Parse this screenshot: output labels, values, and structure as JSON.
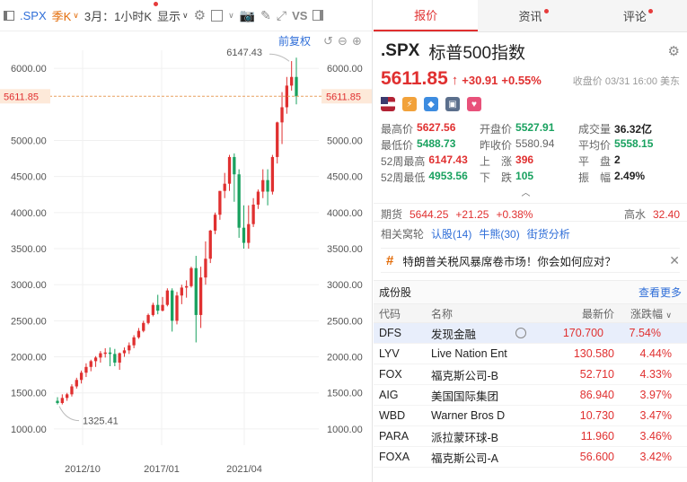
{
  "toolbar": {
    "symbol": ".SPX",
    "period": "季K",
    "interval": "3月：1小时K",
    "display": "显示",
    "vs": "VS",
    "restore": "前复权"
  },
  "chart_data": {
    "type": "candlestick",
    "y_ticks": [
      "1000.00",
      "1500.00",
      "2000.00",
      "2500.00",
      "3000.00",
      "3500.00",
      "4000.00",
      "4500.00",
      "5000.00",
      "6000.00"
    ],
    "x_ticks": [
      "2012/10",
      "2017/01",
      "2021/04"
    ],
    "ylim": [
      775,
      6250
    ],
    "current_price": "5611.85",
    "high_label": "6147.43",
    "low_label": "1325.41",
    "candles": [
      {
        "o": 1390,
        "h": 1440,
        "l": 1340,
        "c": 1360
      },
      {
        "o": 1360,
        "h": 1480,
        "l": 1340,
        "c": 1430
      },
      {
        "o": 1430,
        "h": 1500,
        "l": 1390,
        "c": 1480
      },
      {
        "o": 1480,
        "h": 1620,
        "l": 1450,
        "c": 1590
      },
      {
        "o": 1590,
        "h": 1710,
        "l": 1560,
        "c": 1680
      },
      {
        "o": 1680,
        "h": 1810,
        "l": 1630,
        "c": 1780
      },
      {
        "o": 1780,
        "h": 1910,
        "l": 1720,
        "c": 1860
      },
      {
        "o": 1860,
        "h": 1960,
        "l": 1800,
        "c": 1940
      },
      {
        "o": 1940,
        "h": 2010,
        "l": 1860,
        "c": 1990
      },
      {
        "o": 1990,
        "h": 2080,
        "l": 1920,
        "c": 2050
      },
      {
        "o": 2050,
        "h": 2120,
        "l": 1990,
        "c": 2060
      },
      {
        "o": 2060,
        "h": 2130,
        "l": 1870,
        "c": 2040
      },
      {
        "o": 2040,
        "h": 2110,
        "l": 1870,
        "c": 1920
      },
      {
        "o": 1920,
        "h": 2060,
        "l": 1820,
        "c": 2050
      },
      {
        "o": 2050,
        "h": 2130,
        "l": 2000,
        "c": 2090
      },
      {
        "o": 2090,
        "h": 2200,
        "l": 2040,
        "c": 2160
      },
      {
        "o": 2160,
        "h": 2300,
        "l": 2120,
        "c": 2270
      },
      {
        "o": 2270,
        "h": 2400,
        "l": 2250,
        "c": 2360
      },
      {
        "o": 2360,
        "h": 2500,
        "l": 2340,
        "c": 2470
      },
      {
        "o": 2470,
        "h": 2600,
        "l": 2450,
        "c": 2580
      },
      {
        "o": 2580,
        "h": 2750,
        "l": 2560,
        "c": 2720
      },
      {
        "o": 2720,
        "h": 2860,
        "l": 2590,
        "c": 2640
      },
      {
        "o": 2640,
        "h": 2830,
        "l": 2630,
        "c": 2720
      },
      {
        "o": 2720,
        "h": 2950,
        "l": 2700,
        "c": 2920
      },
      {
        "o": 2920,
        "h": 2950,
        "l": 2350,
        "c": 2500
      },
      {
        "o": 2500,
        "h": 2900,
        "l": 2450,
        "c": 2850
      },
      {
        "o": 2850,
        "h": 3000,
        "l": 2730,
        "c": 2960
      },
      {
        "o": 2960,
        "h": 3060,
        "l": 2820,
        "c": 2980
      },
      {
        "o": 2980,
        "h": 3250,
        "l": 2960,
        "c": 3230
      },
      {
        "o": 3230,
        "h": 3400,
        "l": 2200,
        "c": 2580
      },
      {
        "o": 2580,
        "h": 3250,
        "l": 2400,
        "c": 3100
      },
      {
        "o": 3100,
        "h": 3600,
        "l": 3000,
        "c": 3360
      },
      {
        "o": 3360,
        "h": 3760,
        "l": 3300,
        "c": 3750
      },
      {
        "o": 3750,
        "h": 4000,
        "l": 3700,
        "c": 3970
      },
      {
        "o": 3970,
        "h": 4300,
        "l": 3900,
        "c": 4300
      },
      {
        "o": 4300,
        "h": 4550,
        "l": 4200,
        "c": 4400
      },
      {
        "o": 4400,
        "h": 4800,
        "l": 4300,
        "c": 4770
      },
      {
        "o": 4770,
        "h": 4820,
        "l": 4150,
        "c": 4530
      },
      {
        "o": 4530,
        "h": 4600,
        "l": 3650,
        "c": 3790
      },
      {
        "o": 3790,
        "h": 4100,
        "l": 3500,
        "c": 3580
      },
      {
        "o": 3580,
        "h": 4100,
        "l": 3500,
        "c": 3840
      },
      {
        "o": 3840,
        "h": 4200,
        "l": 3800,
        "c": 4110
      },
      {
        "o": 4110,
        "h": 4320,
        "l": 4050,
        "c": 4290
      },
      {
        "o": 4290,
        "h": 4600,
        "l": 4200,
        "c": 4450
      },
      {
        "o": 4450,
        "h": 4600,
        "l": 4100,
        "c": 4290
      },
      {
        "o": 4290,
        "h": 4800,
        "l": 4250,
        "c": 4770
      },
      {
        "o": 4770,
        "h": 5260,
        "l": 4680,
        "c": 5250
      },
      {
        "o": 5250,
        "h": 5670,
        "l": 4950,
        "c": 5460
      },
      {
        "o": 5460,
        "h": 5880,
        "l": 5370,
        "c": 5760
      },
      {
        "o": 5760,
        "h": 6100,
        "l": 5690,
        "c": 5880
      },
      {
        "o": 5880,
        "h": 6147.43,
        "l": 5500,
        "c": 5611.85
      }
    ]
  },
  "tabs": [
    {
      "label": "报价"
    },
    {
      "label": "资讯"
    },
    {
      "label": "评论"
    }
  ],
  "quote": {
    "code": ".SPX",
    "name": "标普500指数",
    "price": "5611.85",
    "change": "+30.91",
    "pct": "+0.55%",
    "close_info": "收盘价 03/31 16:00 美东"
  },
  "stats": [
    [
      {
        "l": "最高价",
        "v": "5627.56",
        "c": "red"
      },
      {
        "l": "开盘价",
        "v": "5527.91",
        "c": "grn"
      },
      {
        "l": "成交量",
        "v": "36.32亿",
        "c": "blk"
      }
    ],
    [
      {
        "l": "最低价",
        "v": "5488.73",
        "c": "grn"
      },
      {
        "l": "昨收价",
        "v": "5580.94",
        "c": "gry"
      },
      {
        "l": "平均价",
        "v": "5558.15",
        "c": "grn"
      }
    ],
    [
      {
        "l": "52周最高",
        "v": "6147.43",
        "c": "red"
      },
      {
        "l": "上　涨",
        "v": "396",
        "c": "red"
      },
      {
        "l": "平　盘",
        "v": "2",
        "c": "blk"
      }
    ],
    [
      {
        "l": "52周最低",
        "v": "4953.56",
        "c": "grn"
      },
      {
        "l": "下　跌",
        "v": "105",
        "c": "grn"
      },
      {
        "l": "振　幅",
        "v": "2.49%",
        "c": "blk"
      }
    ]
  ],
  "futures": {
    "label": "期货",
    "price": "5644.25",
    "chg": "+21.25",
    "pct": "+0.38%",
    "extra_label": "高水",
    "extra": "32.40"
  },
  "related": {
    "label": "相关窝轮",
    "a": "认股(14)",
    "b": "牛熊(30)",
    "c": "街货分析"
  },
  "news": {
    "text": "特朗普关税风暴席卷市场！你会如何应对？"
  },
  "constituents": {
    "title": "成份股",
    "more": "查看更多",
    "headers": {
      "code": "代码",
      "name": "名称",
      "price": "最新价",
      "pct": "涨跌幅"
    },
    "rows": [
      {
        "code": "DFS",
        "name": "发现金融",
        "price": "170.700",
        "pct": "7.54%"
      },
      {
        "code": "LYV",
        "name": "Live Nation Ent",
        "price": "130.580",
        "pct": "4.44%"
      },
      {
        "code": "FOX",
        "name": "福克斯公司-B",
        "price": "52.710",
        "pct": "4.33%"
      },
      {
        "code": "AIG",
        "name": "美国国际集团",
        "price": "86.940",
        "pct": "3.97%"
      },
      {
        "code": "WBD",
        "name": "Warner Bros D",
        "price": "10.730",
        "pct": "3.47%"
      },
      {
        "code": "PARA",
        "name": "派拉蒙环球-B",
        "price": "11.960",
        "pct": "3.46%"
      },
      {
        "code": "FOXA",
        "name": "福克斯公司-A",
        "price": "56.600",
        "pct": "3.42%"
      }
    ]
  }
}
